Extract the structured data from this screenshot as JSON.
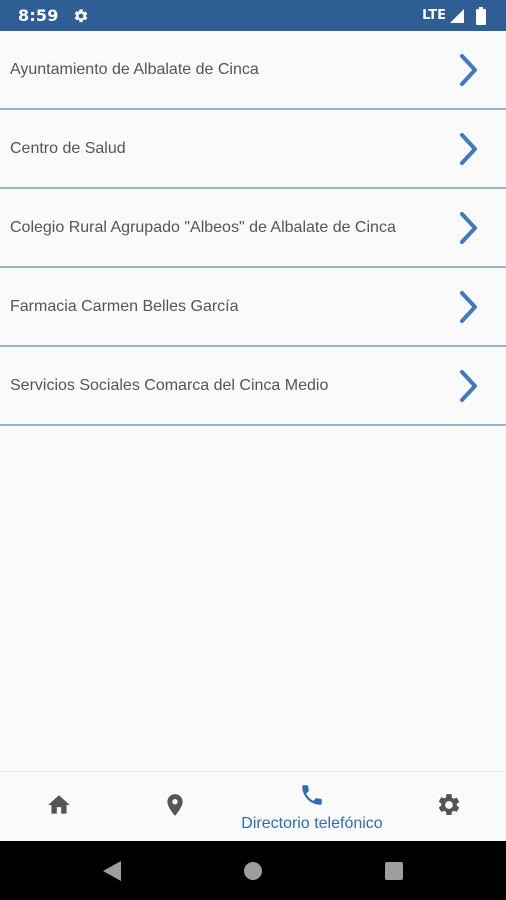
{
  "status_bar": {
    "time": "8:59",
    "network": "LTE",
    "icons": [
      "gear-icon",
      "signal-icon",
      "battery-icon"
    ]
  },
  "directory": {
    "items": [
      {
        "label": "Ayuntamiento de Albalate de Cinca"
      },
      {
        "label": "Centro de Salud"
      },
      {
        "label": "Colegio Rural Agrupado \"Albeos\" de Albalate de Cinca"
      },
      {
        "label": "Farmacia Carmen Belles García"
      },
      {
        "label": "Servicios Sociales Comarca del Cinca Medio"
      }
    ],
    "chevron_icon": "chevron-right-icon"
  },
  "bottom_nav": {
    "items": [
      {
        "icon": "home-icon",
        "label": ""
      },
      {
        "icon": "location-pin-icon",
        "label": ""
      },
      {
        "icon": "phone-icon",
        "label": "Directorio telefónico",
        "active": true
      },
      {
        "icon": "settings-icon",
        "label": ""
      }
    ]
  },
  "system_nav": {
    "buttons": [
      "back-icon",
      "home-circle-icon",
      "recents-icon"
    ]
  },
  "colors": {
    "status_bar": "#2e5e93",
    "accent": "#2e6db5",
    "chevron": "#3f7ac0",
    "divider": "#9cb5c3",
    "nav_icon": "#555555"
  }
}
